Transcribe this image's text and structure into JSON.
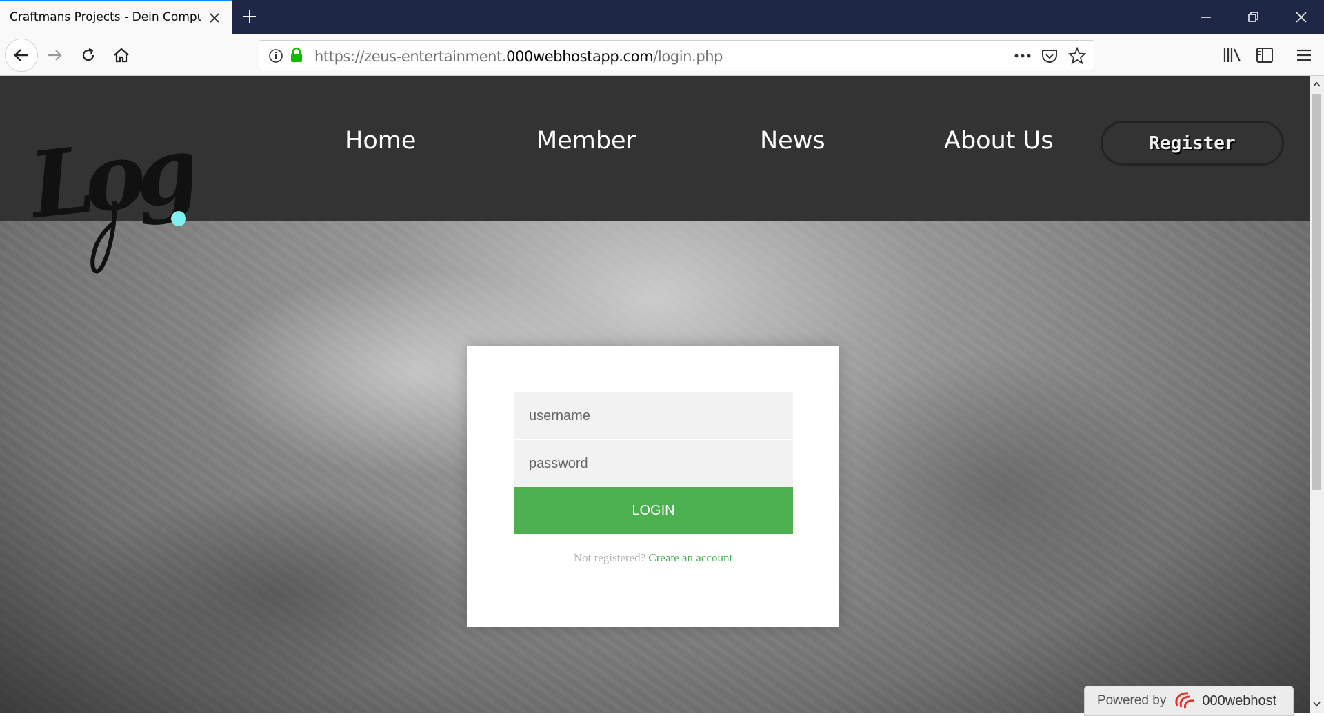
{
  "browser": {
    "tab_title": "Craftmans Projects - Dein Compute",
    "url_prefix": "https://zeus-entertainment.",
    "url_domain": "000webhostapp.com",
    "url_path": "/login.php"
  },
  "site": {
    "logo_text": "Logo",
    "logo_dot_color": "#7ff0ef",
    "nav": [
      {
        "label": "Home"
      },
      {
        "label": "Member"
      },
      {
        "label": "News"
      },
      {
        "label": "About Us"
      }
    ],
    "register_label": "Register"
  },
  "login": {
    "username_placeholder": "username",
    "password_placeholder": "password",
    "login_label": "LOGIN",
    "not_registered": "Not registered?",
    "create_account": "Create an account",
    "accent_color": "#4caf50"
  },
  "footer_badge": {
    "powered_by": "Powered by",
    "brand": "000webhost"
  }
}
